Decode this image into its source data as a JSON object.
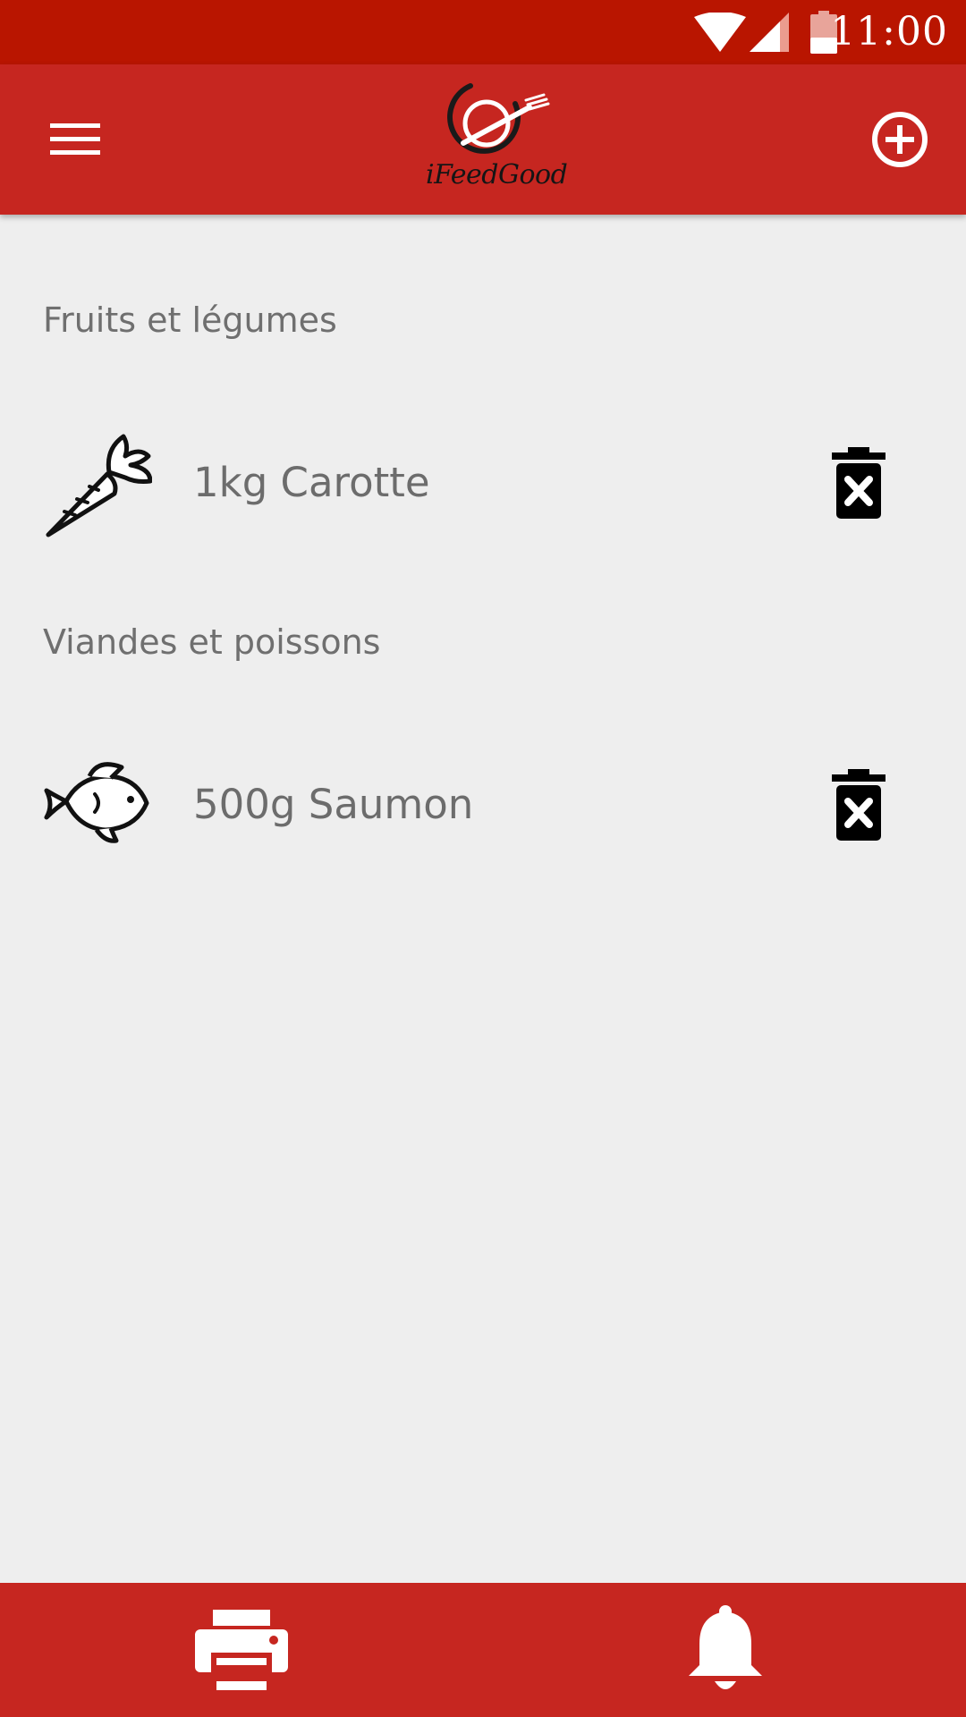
{
  "status_bar": {
    "time": "11:00",
    "icons": [
      "wifi-icon",
      "signal-icon",
      "battery-low-icon"
    ],
    "background_color": "#b91500"
  },
  "app_bar": {
    "logo_text": "iFeedGood",
    "menu_icon": "hamburger-menu-icon",
    "add_icon": "add-circle-icon",
    "background_color": "#c62620"
  },
  "sections": [
    {
      "title": "Fruits et légumes",
      "items": [
        {
          "label": "1kg Carotte",
          "icon": "carrot-icon",
          "delete_icon": "trash-delete-icon"
        }
      ]
    },
    {
      "title": "Viandes et poissons",
      "items": [
        {
          "label": "500g Saumon",
          "icon": "fish-icon",
          "delete_icon": "trash-delete-icon"
        }
      ]
    }
  ],
  "bottom_bar": {
    "icons": [
      "printer-icon",
      "bell-icon"
    ],
    "background_color": "#c62620"
  },
  "colors": {
    "page_background": "#eeeeee",
    "text": "#6c6c6c"
  }
}
